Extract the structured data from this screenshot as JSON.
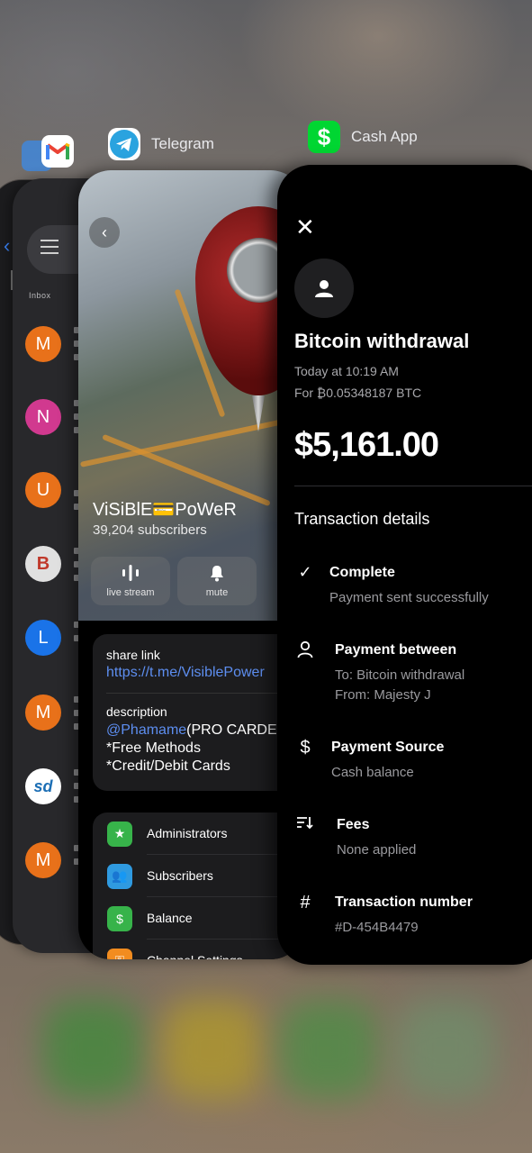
{
  "app_switcher": {
    "telegram_label": "Telegram",
    "cashapp_label": "Cash App",
    "icons": {
      "mail": "mail-app-icon",
      "gmail": "gmail-app-icon",
      "telegram": "telegram-app-icon",
      "cashapp": "cash-app-icon"
    }
  },
  "gmail": {
    "inbox_label": "Inbox",
    "avatars": [
      {
        "letter": "M",
        "color": "#e8711a"
      },
      {
        "letter": "N",
        "color": "#d1398f"
      },
      {
        "letter": "U",
        "color": "#e8711a"
      },
      {
        "letter": "B",
        "color": "#e0e0e0"
      },
      {
        "letter": "L",
        "color": "#1a73e8"
      },
      {
        "letter": "M",
        "color": "#e8711a"
      },
      {
        "letter": "sd",
        "color": "#ffffff"
      },
      {
        "letter": "M",
        "color": "#e8711a"
      }
    ]
  },
  "telegram": {
    "channel_name": "ViSiBlE💳PoWeR",
    "subscribers": "39,204 subscribers",
    "actions": [
      {
        "label": "live stream",
        "icon": "live-stream-icon"
      },
      {
        "label": "mute",
        "icon": "bell-icon"
      }
    ],
    "share_link_label": "share link",
    "share_link_value": "https://t.me/VisiblePower",
    "description_label": "description",
    "description_mention": "@Phamame",
    "description_rest": "(PRO CARDER",
    "description_line2": "*Free Methods",
    "description_line3": "*Credit/Debit Cards",
    "menu": [
      {
        "label": "Administrators",
        "icon": "admin-shield-icon",
        "color": "#37b34a"
      },
      {
        "label": "Subscribers",
        "icon": "people-icon",
        "color": "#2f9ae0"
      },
      {
        "label": "Balance",
        "icon": "dollar-icon",
        "color": "#37b34a"
      },
      {
        "label": "Channel Settings",
        "icon": "key-icon",
        "color": "#f28c1f"
      }
    ]
  },
  "cashapp": {
    "title": "Bitcoin withdrawal",
    "date": "Today at 10:19 AM",
    "for_text": "For ₿0.05348187 BTC",
    "amount": "$5,161.00",
    "section_title": "Transaction details",
    "details": [
      {
        "icon": "check-icon",
        "title": "Complete",
        "subtitle": "Payment sent successfully"
      },
      {
        "icon": "person-icon",
        "title": "Payment between",
        "subtitle": "To: Bitcoin withdrawal",
        "subtitle2": "From: Majesty J"
      },
      {
        "icon": "dollar-sign-icon",
        "title": "Payment Source",
        "subtitle": "Cash balance"
      },
      {
        "icon": "fees-icon",
        "title": "Fees",
        "subtitle": "None applied"
      },
      {
        "icon": "hash-icon",
        "title": "Transaction number",
        "subtitle": "#D-454B4479"
      }
    ]
  },
  "colors": {
    "cash_green": "#00d632",
    "telegram_blue": "#2aa3df",
    "link_blue": "#5d8ef0"
  }
}
